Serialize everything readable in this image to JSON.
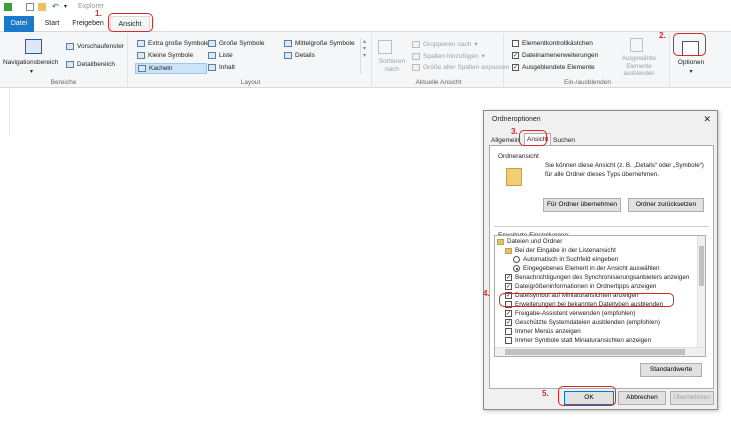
{
  "window": {
    "title": "Explorer"
  },
  "tabs": [
    "Datei",
    "Start",
    "Freigeben",
    "Ansicht"
  ],
  "steps": [
    "1.",
    "2.",
    "3.",
    "4.",
    "5."
  ],
  "ribbon": {
    "bereiche": {
      "label": "Bereiche",
      "navigationsbereich": "Navigationsbereich",
      "vorschaufenster": "Vorschaufenster",
      "detailbereich": "Detailbereich"
    },
    "layout": {
      "label": "Layout",
      "items": [
        "Extra große Symbole",
        "Große Symbole",
        "Mittelgroße Symbole",
        "Kleine Symbole",
        "Liste",
        "Details",
        "Kacheln",
        "Inhalt"
      ]
    },
    "aktuelle_ansicht": {
      "label": "Aktuelle Ansicht",
      "sortieren": "Sortieren nach",
      "gruppieren": "Gruppieren nach",
      "spalten": "Spalten hinzufügen",
      "groesse": "Größe aller Spalten anpassen"
    },
    "ein_ausblenden": {
      "label": "Ein-/ausblenden",
      "elementkontrollkaestchen": "Elementkontrollkästchen",
      "dateinamenerweiterungen": "Dateinamenerweiterungen",
      "ausgeblendete": "Ausgeblendete Elemente",
      "ausgewaehlte": "Ausgewählte Elemente ausblenden"
    },
    "optionen": "Optionen"
  },
  "dialog": {
    "title": "Ordneroptionen",
    "tabs": [
      "Allgemein",
      "Ansicht",
      "Suchen"
    ],
    "ordneransicht": {
      "heading": "Ordneransicht",
      "text": "Sie können diese Ansicht (z. B. „Details“ oder „Symbole“) für alle Ordner dieses Typs übernehmen.",
      "btn_apply": "Für Ordner übernehmen",
      "btn_reset": "Ordner zurücksetzen"
    },
    "erweiterte_label": "Erweiterte Einstellungen:",
    "settings": [
      "Dateien und Ordner",
      "Bei der Eingabe in der Listenansicht",
      "Automatisch in Suchfeld eingeben",
      "Eingegebenes Element in der Ansicht auswählen",
      "Benachrichtigungen des Synchronisierungsanbieters anzeigen",
      "Dateigrößeninformationen in Ordnertipps anzeigen",
      "Dateisymbol auf Miniaturansichten anzeigen",
      "Erweiterungen bei bekannten Dateitypen ausblenden",
      "Freigabe-Assistent verwenden (empfohlen)",
      "Geschützte Systemdateien ausblenden (empfohlen)",
      "Immer Menüs anzeigen",
      "Immer Symbole statt Miniaturansichten anzeigen"
    ],
    "standardwerte": "Standardwerte",
    "ok": "OK",
    "abbrechen": "Abbrechen",
    "uebernehmen": "Übernehmen"
  },
  "colors": {
    "accent": "#1979ca",
    "annotation": "#d32a2a"
  }
}
